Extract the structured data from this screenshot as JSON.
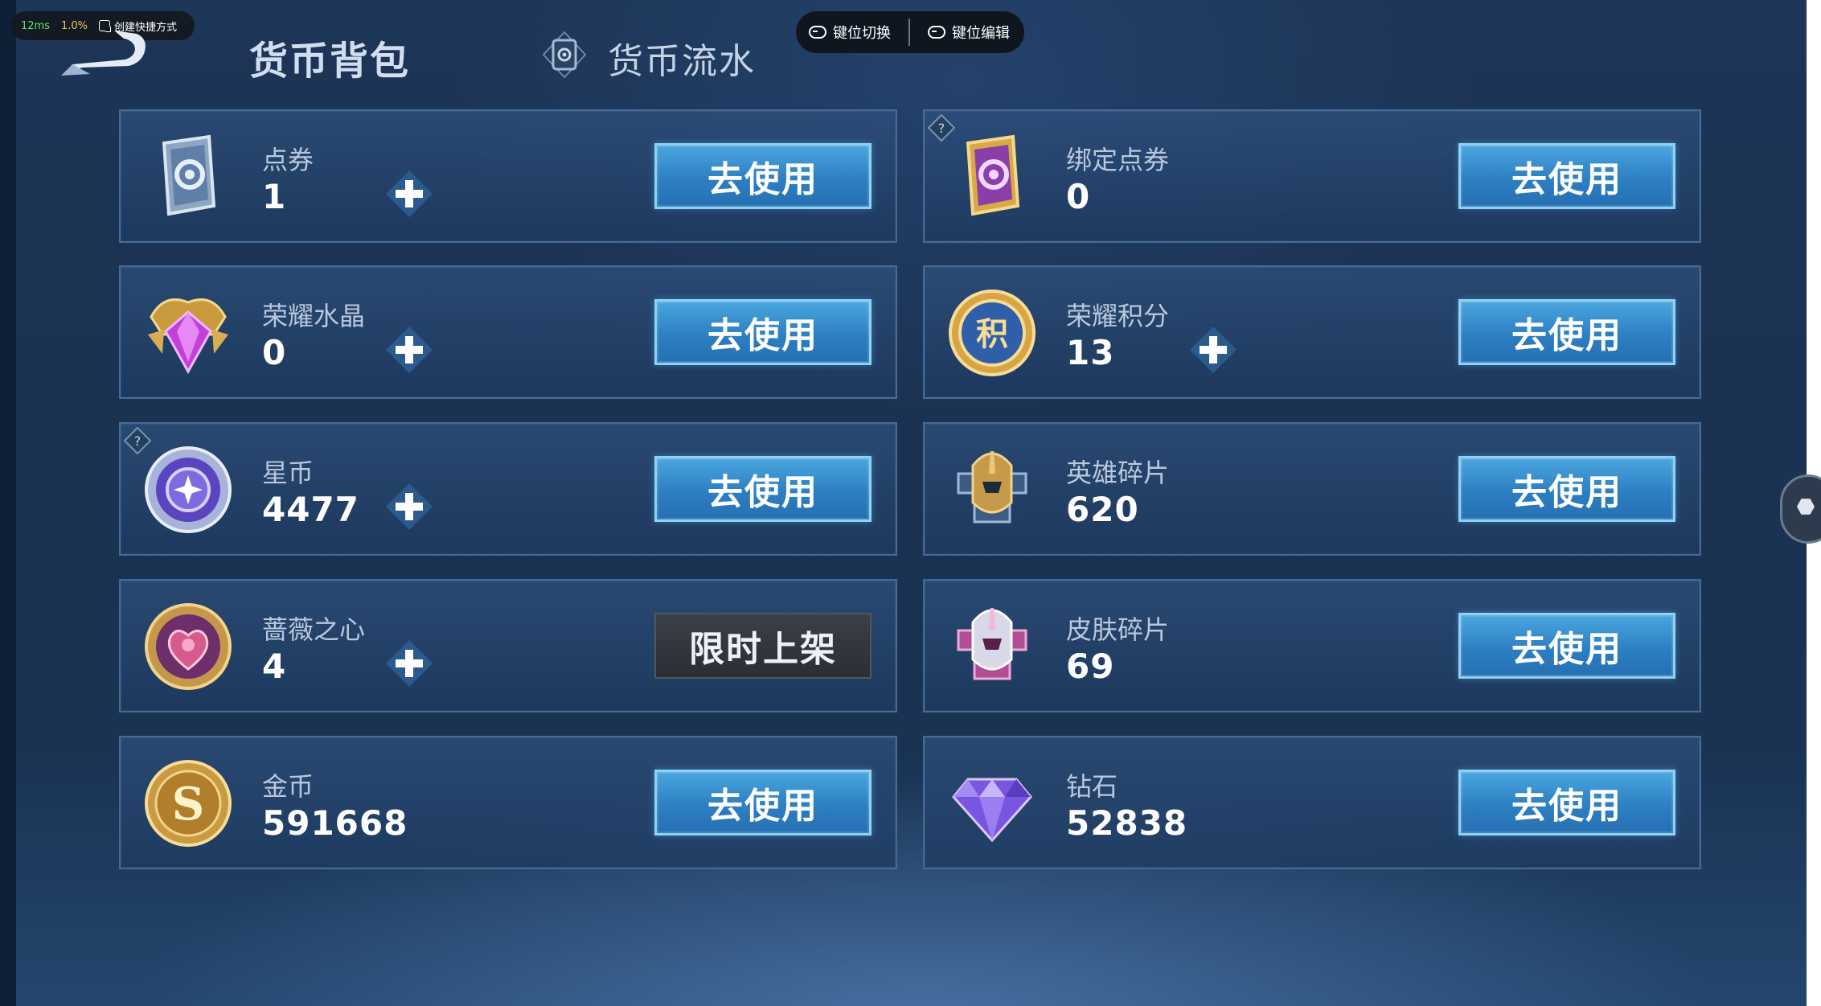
{
  "overlay": {
    "ping": "12ms",
    "load": "1.0%",
    "shortcut_label": "创建快捷方式"
  },
  "header": {
    "tab_active": "货币背包",
    "tab_history": "货币流水"
  },
  "keymap": {
    "switch_label": "键位切换",
    "edit_label": "键位编辑"
  },
  "currencies": [
    {
      "name": "点券",
      "value": "1",
      "icon": "coupon-card-icon",
      "action": "去使用",
      "plus": true,
      "help": false
    },
    {
      "name": "绑定点券",
      "value": "0",
      "icon": "bound-coupon-card-icon",
      "action": "去使用",
      "plus": false,
      "help": true
    },
    {
      "name": "荣耀水晶",
      "value": "0",
      "icon": "glory-crystal-icon",
      "action": "去使用",
      "plus": true,
      "help": false
    },
    {
      "name": "荣耀积分",
      "value": "13",
      "icon": "glory-points-icon",
      "action": "去使用",
      "plus": true,
      "help": false
    },
    {
      "name": "星币",
      "value": "4477",
      "icon": "star-coin-icon",
      "action": "去使用",
      "plus": true,
      "help": true
    },
    {
      "name": "英雄碎片",
      "value": "620",
      "icon": "hero-fragment-icon",
      "action": "去使用",
      "plus": false,
      "help": false
    },
    {
      "name": "蔷薇之心",
      "value": "4",
      "icon": "rose-heart-icon",
      "action": "限时上架",
      "plus": true,
      "help": false
    },
    {
      "name": "皮肤碎片",
      "value": "69",
      "icon": "skin-fragment-icon",
      "action": "去使用",
      "plus": false,
      "help": false
    },
    {
      "name": "金币",
      "value": "591668",
      "icon": "gold-coin-icon",
      "action": "去使用",
      "plus": false,
      "help": false
    },
    {
      "name": "钻石",
      "value": "52838",
      "icon": "diamond-icon",
      "action": "去使用",
      "plus": false,
      "help": false
    }
  ],
  "colors": {
    "button_blue": "#2d7fc2",
    "button_border": "#8dd2f4",
    "limited_button": "#2b2f35",
    "card_border": "#476a95"
  }
}
